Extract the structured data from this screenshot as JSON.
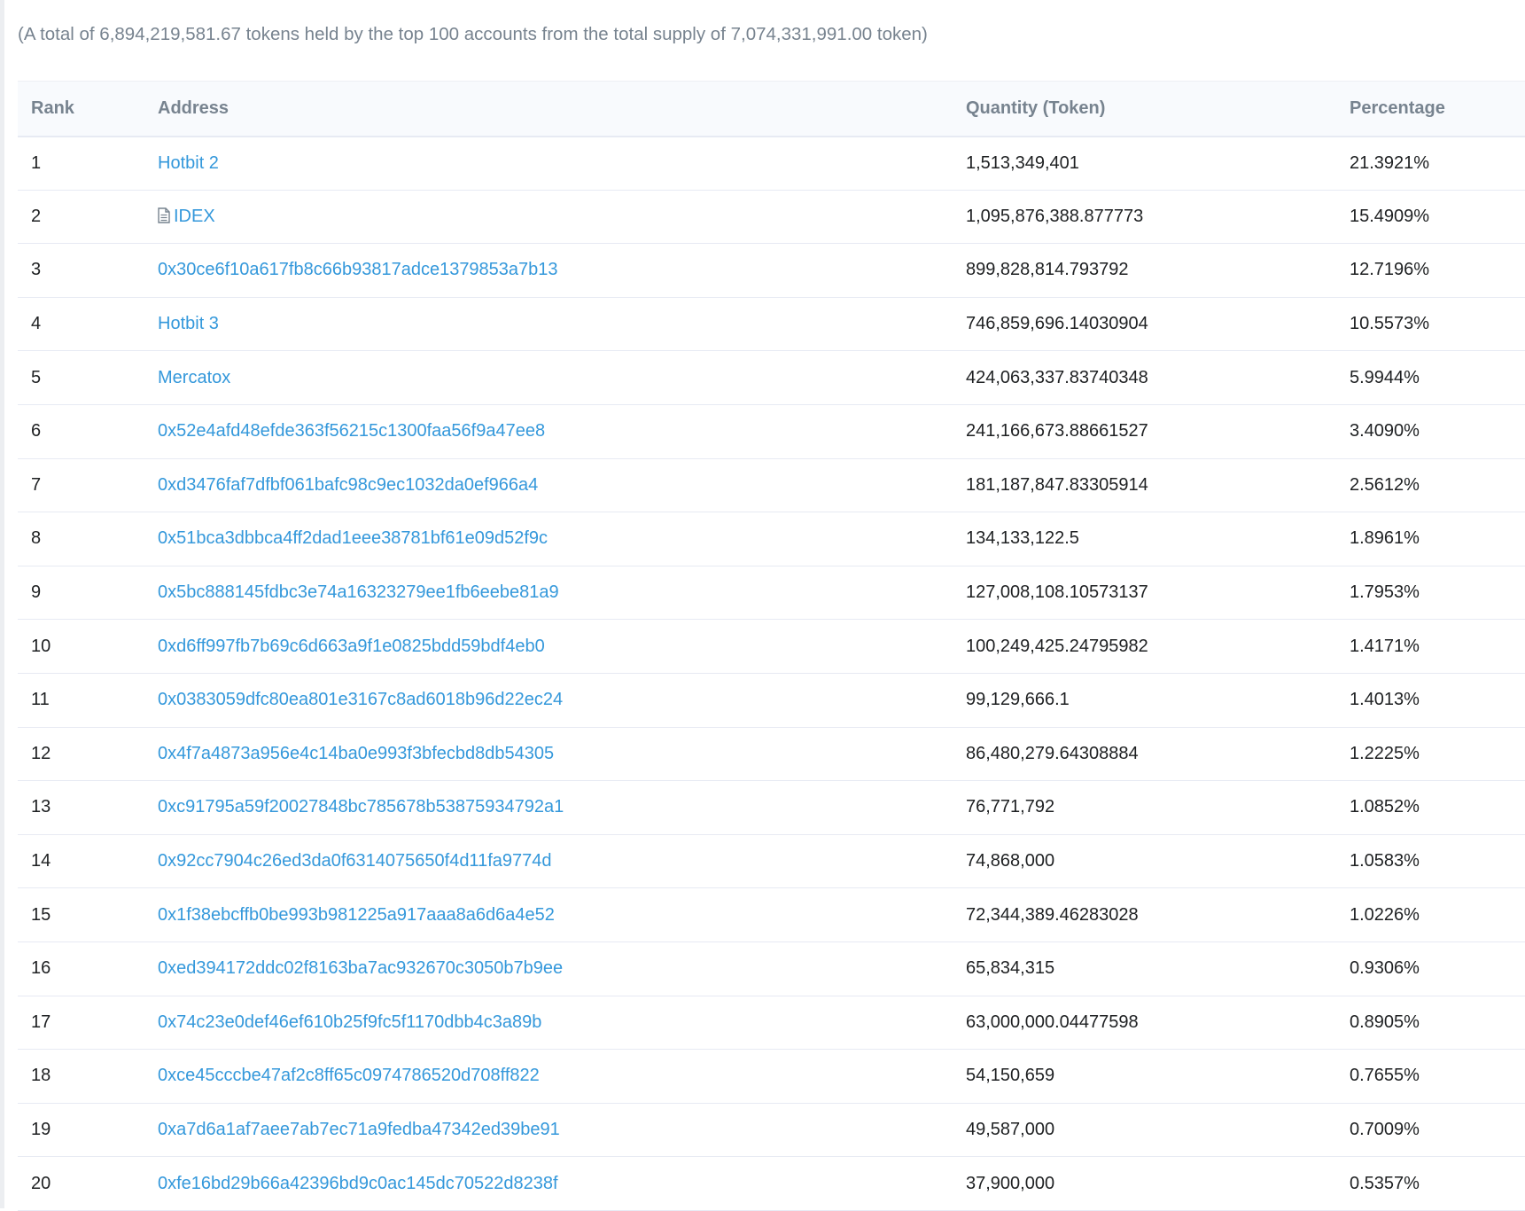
{
  "summary": "(A total of 6,894,219,581.67 tokens held by the top 100 accounts from the total supply of 7,074,331,991.00 token)",
  "table": {
    "headers": {
      "rank": "Rank",
      "address": "Address",
      "quantity": "Quantity (Token)",
      "percentage": "Percentage"
    },
    "rows": [
      {
        "rank": "1",
        "address": "Hotbit 2",
        "contract": false,
        "quantity": "1,513,349,401",
        "percentage": "21.3921%"
      },
      {
        "rank": "2",
        "address": "IDEX",
        "contract": true,
        "quantity": "1,095,876,388.877773",
        "percentage": "15.4909%"
      },
      {
        "rank": "3",
        "address": "0x30ce6f10a617fb8c66b93817adce1379853a7b13",
        "contract": false,
        "quantity": "899,828,814.793792",
        "percentage": "12.7196%"
      },
      {
        "rank": "4",
        "address": "Hotbit 3",
        "contract": false,
        "quantity": "746,859,696.14030904",
        "percentage": "10.5573%"
      },
      {
        "rank": "5",
        "address": "Mercatox",
        "contract": false,
        "quantity": "424,063,337.83740348",
        "percentage": "5.9944%"
      },
      {
        "rank": "6",
        "address": "0x52e4afd48efde363f56215c1300faa56f9a47ee8",
        "contract": false,
        "quantity": "241,166,673.88661527",
        "percentage": "3.4090%"
      },
      {
        "rank": "7",
        "address": "0xd3476faf7dfbf061bafc98c9ec1032da0ef966a4",
        "contract": false,
        "quantity": "181,187,847.83305914",
        "percentage": "2.5612%"
      },
      {
        "rank": "8",
        "address": "0x51bca3dbbca4ff2dad1eee38781bf61e09d52f9c",
        "contract": false,
        "quantity": "134,133,122.5",
        "percentage": "1.8961%"
      },
      {
        "rank": "9",
        "address": "0x5bc888145fdbc3e74a16323279ee1fb6eebe81a9",
        "contract": false,
        "quantity": "127,008,108.10573137",
        "percentage": "1.7953%"
      },
      {
        "rank": "10",
        "address": "0xd6ff997fb7b69c6d663a9f1e0825bdd59bdf4eb0",
        "contract": false,
        "quantity": "100,249,425.24795982",
        "percentage": "1.4171%"
      },
      {
        "rank": "11",
        "address": "0x0383059dfc80ea801e3167c8ad6018b96d22ec24",
        "contract": false,
        "quantity": "99,129,666.1",
        "percentage": "1.4013%"
      },
      {
        "rank": "12",
        "address": "0x4f7a4873a956e4c14ba0e993f3bfecbd8db54305",
        "contract": false,
        "quantity": "86,480,279.64308884",
        "percentage": "1.2225%"
      },
      {
        "rank": "13",
        "address": "0xc91795a59f20027848bc785678b53875934792a1",
        "contract": false,
        "quantity": "76,771,792",
        "percentage": "1.0852%"
      },
      {
        "rank": "14",
        "address": "0x92cc7904c26ed3da0f6314075650f4d11fa9774d",
        "contract": false,
        "quantity": "74,868,000",
        "percentage": "1.0583%"
      },
      {
        "rank": "15",
        "address": "0x1f38ebcffb0be993b981225a917aaa8a6d6a4e52",
        "contract": false,
        "quantity": "72,344,389.46283028",
        "percentage": "1.0226%"
      },
      {
        "rank": "16",
        "address": "0xed394172ddc02f8163ba7ac932670c3050b7b9ee",
        "contract": false,
        "quantity": "65,834,315",
        "percentage": "0.9306%"
      },
      {
        "rank": "17",
        "address": "0x74c23e0def46ef610b25f9fc5f1170dbb4c3a89b",
        "contract": false,
        "quantity": "63,000,000.04477598",
        "percentage": "0.8905%"
      },
      {
        "rank": "18",
        "address": "0xce45cccbe47af2c8ff65c0974786520d708ff822",
        "contract": false,
        "quantity": "54,150,659",
        "percentage": "0.7655%"
      },
      {
        "rank": "19",
        "address": "0xa7d6a1af7aee7ab7ec71a9fedba47342ed39be91",
        "contract": false,
        "quantity": "49,587,000",
        "percentage": "0.7009%"
      },
      {
        "rank": "20",
        "address": "0xfe16bd29b66a42396bd9c0ac145dc70522d8238f",
        "contract": false,
        "quantity": "37,900,000",
        "percentage": "0.5357%"
      }
    ]
  },
  "colors": {
    "link": "#3498db",
    "muted": "#77838f",
    "text": "#1e2022",
    "header_bg": "#f8fafd",
    "row_border": "#e7eaf3"
  },
  "icons": {
    "contract": "document-icon"
  }
}
